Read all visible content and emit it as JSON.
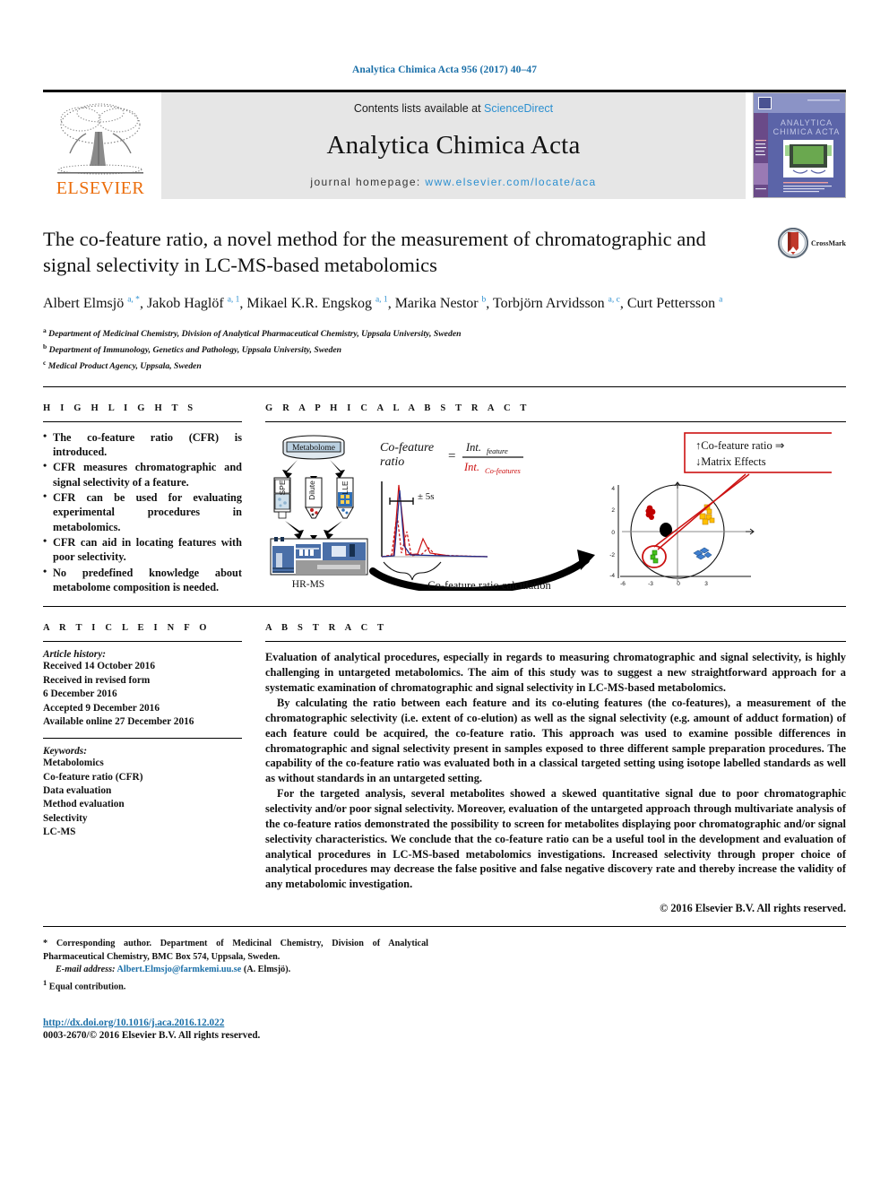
{
  "running_head": "Analytica Chimica Acta 956 (2017) 40–47",
  "masthead": {
    "contents_prefix": "Contents lists available at ",
    "sciencedirect": "ScienceDirect",
    "journal_name": "Analytica Chimica Acta",
    "homepage_prefix": "journal homepage: ",
    "homepage_url": "www.elsevier.com/locate/aca",
    "publisher_logo_text": "ELSEVIER",
    "cover_title": "ANALYTICA CHIMICA ACTA",
    "accent_blue": "#2b8fd0",
    "elsevier_orange": "#eb6d0b"
  },
  "article": {
    "title": "The co-feature ratio, a novel method for the measurement of chromatographic and signal selectivity in LC-MS-based metabolomics",
    "crossmark_label": "CrossMark",
    "authors_html": "Albert Elmsjö <sup>a, *</sup>, Jakob Haglöf <sup>a, 1</sup>, Mikael K.R. Engskog <sup>a, 1</sup>, Marika Nestor <sup>b</sup>, Torbjörn Arvidsson <sup>a, c</sup>, Curt Pettersson <sup>a</sup>",
    "affiliations": [
      {
        "marker": "a",
        "text": "Department of Medicinal Chemistry, Division of Analytical Pharmaceutical Chemistry, Uppsala University, Sweden"
      },
      {
        "marker": "b",
        "text": "Department of Immunology, Genetics and Pathology, Uppsala University, Sweden"
      },
      {
        "marker": "c",
        "text": "Medical Product Agency, Uppsala, Sweden"
      }
    ]
  },
  "highlights": {
    "heading": "H I G H L I G H T S",
    "items": [
      "The co-feature ratio (CFR) is introduced.",
      "CFR measures chromatographic and signal selectivity of a feature.",
      "CFR can be used for evaluating experimental procedures in metabolomics.",
      "CFR can aid in locating features with poor selectivity.",
      "No predefined knowledge about metabolome composition is needed."
    ]
  },
  "graphical_abstract": {
    "heading": "G R A P H I C A L  A B S T R A C T",
    "labels": {
      "metabolome": "Metabolome",
      "prep_spe": "SPE",
      "prep_dilute": "Dilute",
      "prep_lle": "LLE",
      "instrument": "HR-MS",
      "formula_lhs_line1": "Co-feature",
      "formula_lhs_line2": "ratio",
      "formula_equals": "=",
      "formula_numerator": "Int.",
      "formula_numerator_sub": "feature",
      "formula_denominator": "Int.",
      "formula_denominator_sub": "Co-features",
      "peak_window": "± 5s",
      "calculation_caption": "Co-feature ratio calculation",
      "callout_line1": "↑Co-feature ratio ⇒",
      "callout_line2": "↓Matrix Effects"
    },
    "scatter_axis": {
      "x_ticks": [
        "-6",
        "-3",
        "0",
        "3"
      ],
      "y_ticks": [
        "4",
        "2",
        "0",
        "-2",
        "-4"
      ]
    },
    "colors": {
      "denominator_red": "#cc1111",
      "callout_border": "#cc1111",
      "cluster_red": "#c00000",
      "cluster_yellow": "#ffc000",
      "cluster_blue": "#3f7fd0",
      "cluster_green": "#44c11a",
      "cluster_black": "#000000"
    }
  },
  "article_info": {
    "heading": "A R T I C L E  I N F O",
    "history_label": "Article history:",
    "history": [
      "Received 14 October 2016",
      "Received in revised form",
      "6 December 2016",
      "Accepted 9 December 2016",
      "Available online 27 December 2016"
    ],
    "keywords_label": "Keywords:",
    "keywords": [
      "Metabolomics",
      "Co-feature ratio (CFR)",
      "Data evaluation",
      "Method evaluation",
      "Selectivity",
      "LC-MS"
    ]
  },
  "abstract": {
    "heading": "A B S T R A C T",
    "paragraphs": [
      "Evaluation of analytical procedures, especially in regards to measuring chromatographic and signal selectivity, is highly challenging in untargeted metabolomics. The aim of this study was to suggest a new straightforward approach for a systematic examination of chromatographic and signal selectivity in LC-MS-based metabolomics.",
      "By calculating the ratio between each feature and its co-eluting features (the co-features), a measurement of the chromatographic selectivity (i.e. extent of co-elution) as well as the signal selectivity (e.g. amount of adduct formation) of each feature could be acquired, the co-feature ratio. This approach was used to examine possible differences in chromatographic and signal selectivity present in samples exposed to three different sample preparation procedures. The capability of the co-feature ratio was evaluated both in a classical targeted setting using isotope labelled standards as well as without standards in an untargeted setting.",
      "For the targeted analysis, several metabolites showed a skewed quantitative signal due to poor chromatographic selectivity and/or poor signal selectivity. Moreover, evaluation of the untargeted approach through multivariate analysis of the co-feature ratios demonstrated the possibility to screen for metabolites displaying poor chromatographic and/or signal selectivity characteristics. We conclude that the co-feature ratio can be a useful tool in the development and evaluation of analytical procedures in LC-MS-based metabolomics investigations. Increased selectivity through proper choice of analytical procedures may decrease the false positive and false negative discovery rate and thereby increase the validity of any metabolomic investigation."
    ],
    "copyright": "© 2016 Elsevier B.V. All rights reserved."
  },
  "footnotes": {
    "corresponding_marker": "*",
    "corresponding_text": "Corresponding author. Department of Medicinal Chemistry, Division of Analytical Pharmaceutical Chemistry, BMC Box 574, Uppsala, Sweden.",
    "email_label": "E-mail address:",
    "email": "Albert.Elmsjo@farmkemi.uu.se",
    "email_suffix": "(A. Elmsjö).",
    "equal_marker": "1",
    "equal_text": "Equal contribution."
  },
  "footer": {
    "doi": "http://dx.doi.org/10.1016/j.aca.2016.12.022",
    "issn_line": "0003-2670/© 2016 Elsevier B.V. All rights reserved."
  }
}
